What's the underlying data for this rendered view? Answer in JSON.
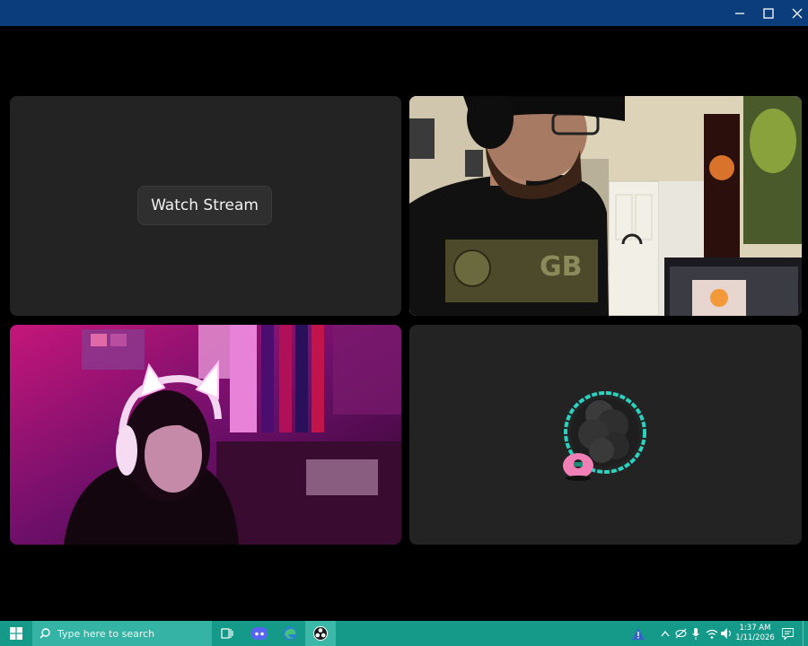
{
  "window": {
    "controls": {
      "minimize_icon": "minimize-icon",
      "maximize_icon": "maximize-icon",
      "close_icon": "close-icon"
    }
  },
  "tiles": [
    {
      "id": "stream-tile",
      "type": "placeholder",
      "button_label": "Watch Stream"
    },
    {
      "id": "camera-man",
      "type": "video"
    },
    {
      "id": "camera-woman",
      "type": "video"
    },
    {
      "id": "avatar-tile",
      "type": "avatar",
      "ring_color": "#2ad3c0"
    }
  ],
  "taskbar": {
    "start_icon": "windows-start-icon",
    "search_placeholder": "Type here to search",
    "apps": [
      "task-view-icon",
      "discord-icon",
      "edge-icon",
      "obs-icon"
    ],
    "tray": {
      "time": "1:37 AM",
      "date": "1/11/2026"
    }
  }
}
